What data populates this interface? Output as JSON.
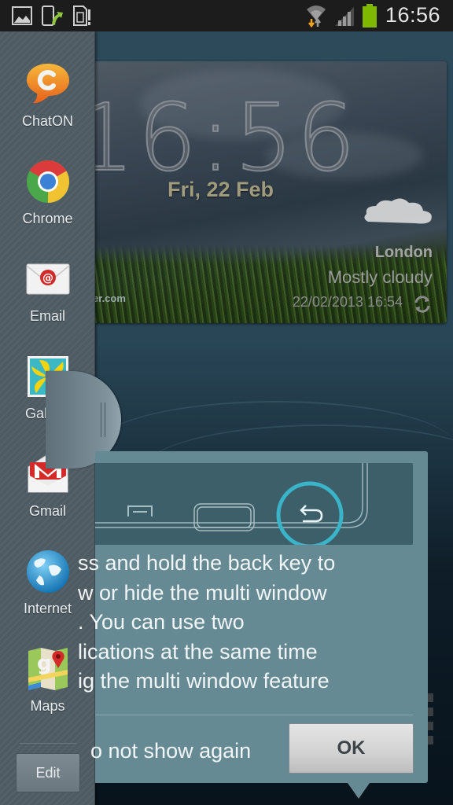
{
  "status_bar": {
    "time": "16:56",
    "left_icons": [
      "gallery-notification-icon",
      "upload-notification-icon",
      "sim-card-alert-icon"
    ],
    "right_icons": [
      "wifi-icon",
      "signal-icon",
      "battery-icon"
    ],
    "battery_color": "#7fb800"
  },
  "sidebar": {
    "items": [
      {
        "label": "ChatON",
        "icon": "chaton-icon"
      },
      {
        "label": "Chrome",
        "icon": "chrome-icon"
      },
      {
        "label": "Email",
        "icon": "email-icon"
      },
      {
        "label": "Gallery",
        "icon": "gallery-icon"
      },
      {
        "label": "Gmail",
        "icon": "gmail-icon"
      },
      {
        "label": "Internet",
        "icon": "internet-icon"
      },
      {
        "label": "Maps",
        "icon": "maps-icon"
      }
    ],
    "edit_label": "Edit"
  },
  "weather_widget": {
    "clock": "16:56",
    "date": "Fri, 22 Feb",
    "city": "London",
    "condition": "Mostly cloudy",
    "updated": "22/02/2013 16:54",
    "brand_fragment": "er.com"
  },
  "dialog": {
    "message_lines": [
      "ss and hold the back key to",
      "w or hide the multi window",
      ". You can use two",
      "lications at the same time",
      "ig the multi window feature"
    ],
    "checkbox_label": "o not show again",
    "ok_label": "OK",
    "highlight_color": "#3ab4c8"
  }
}
